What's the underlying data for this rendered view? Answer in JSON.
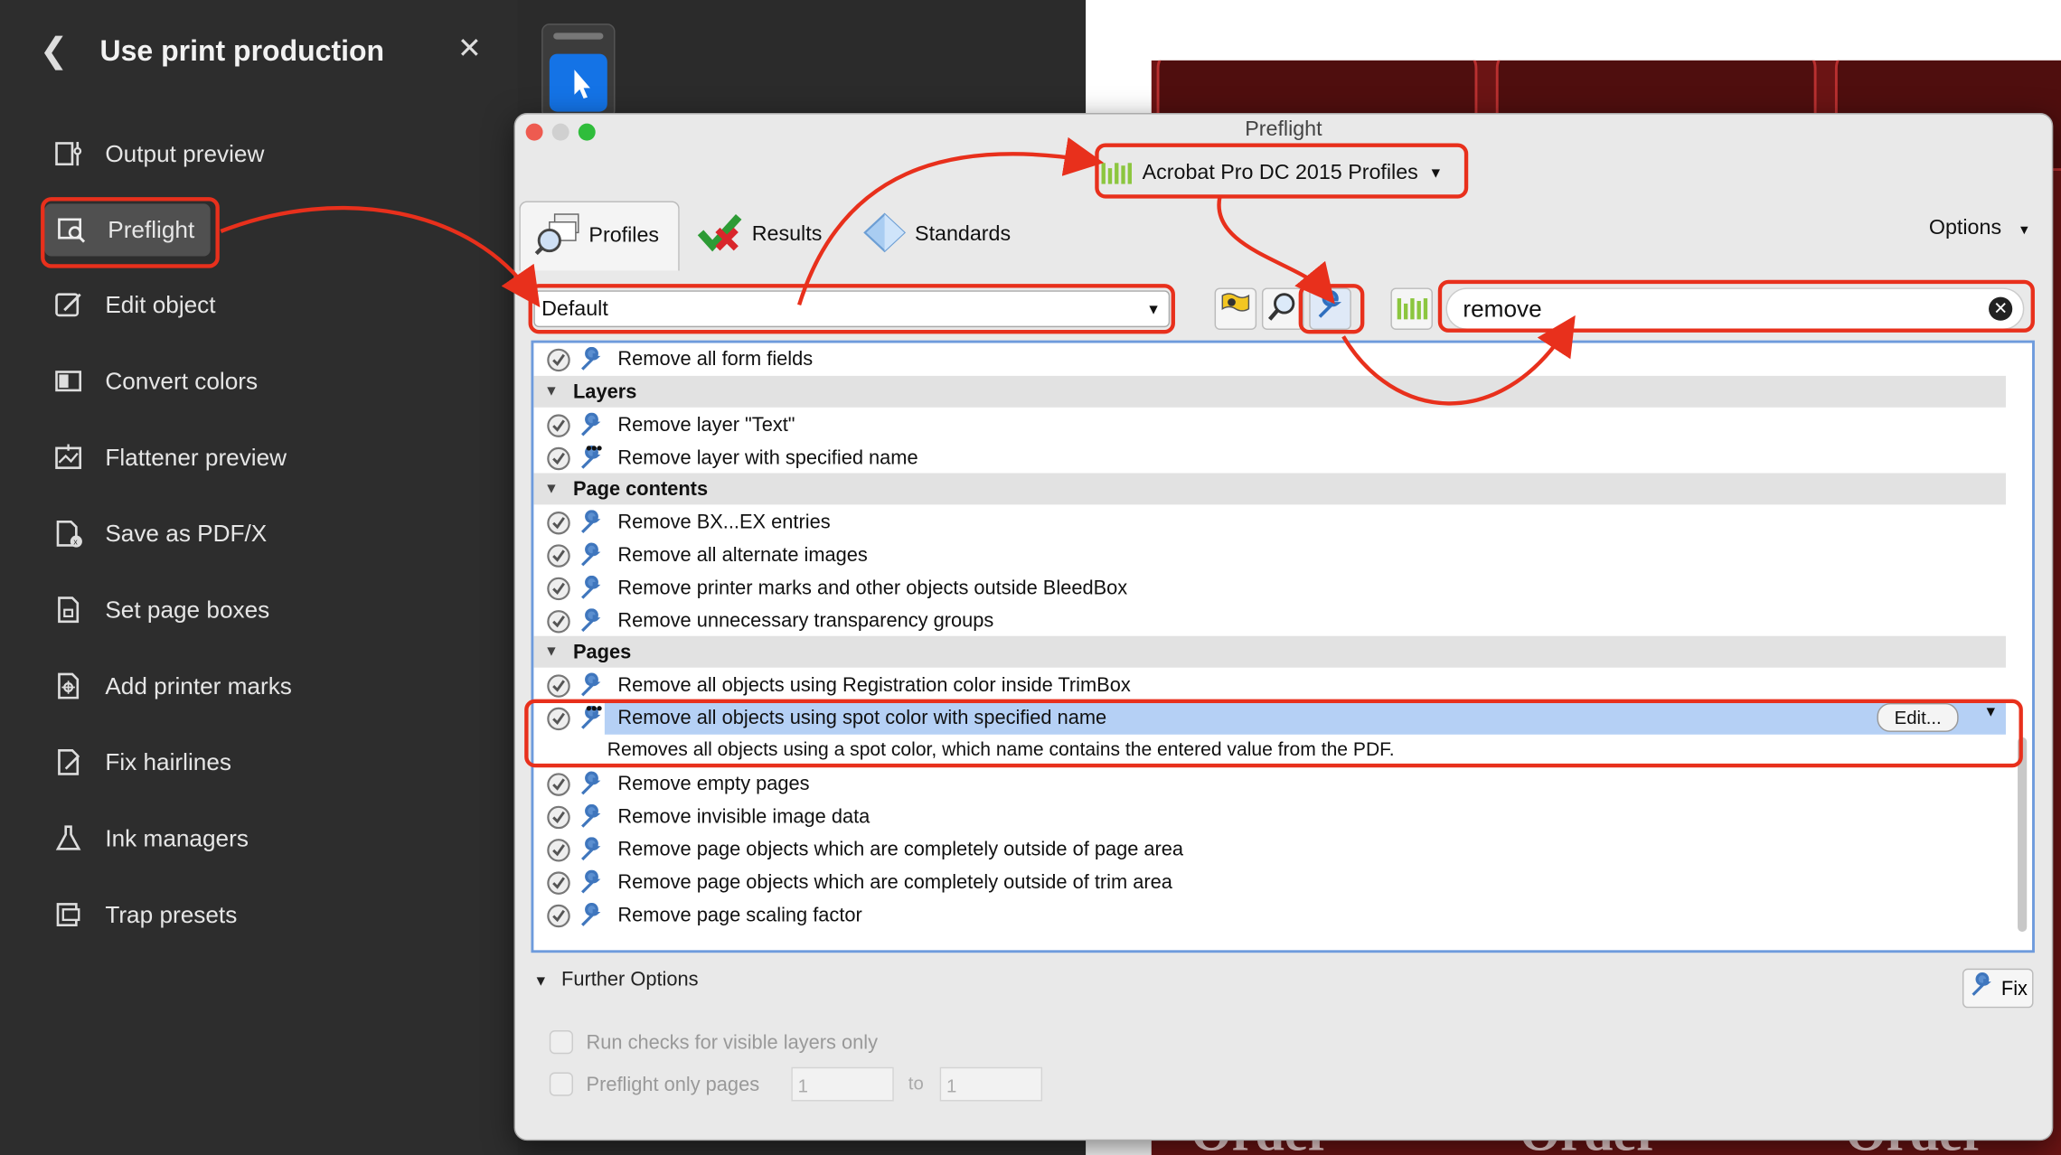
{
  "sidebar": {
    "title": "Use print production",
    "items": [
      {
        "label": "Output preview",
        "icon": "output-preview-icon"
      },
      {
        "label": "Preflight",
        "icon": "preflight-icon",
        "active": true
      },
      {
        "label": "Edit object",
        "icon": "edit-object-icon"
      },
      {
        "label": "Convert colors",
        "icon": "convert-colors-icon"
      },
      {
        "label": "Flattener preview",
        "icon": "flattener-preview-icon"
      },
      {
        "label": "Save as PDF/X",
        "icon": "save-pdfx-icon"
      },
      {
        "label": "Set page boxes",
        "icon": "page-boxes-icon"
      },
      {
        "label": "Add printer marks",
        "icon": "printer-marks-icon"
      },
      {
        "label": "Fix hairlines",
        "icon": "fix-hairlines-icon"
      },
      {
        "label": "Ink managers",
        "icon": "ink-managers-icon"
      },
      {
        "label": "Trap presets",
        "icon": "trap-presets-icon"
      }
    ]
  },
  "window": {
    "title": "Preflight",
    "profile_set": "Acrobat Pro DC 2015 Profiles",
    "tabs": [
      {
        "label": "Profiles",
        "active": true
      },
      {
        "label": "Results"
      },
      {
        "label": "Standards"
      }
    ],
    "options_label": "Options",
    "library_select": "Default",
    "search_value": "remove",
    "top_item": "Remove all form fields",
    "groups": [
      {
        "name": "Layers",
        "items": [
          "Remove layer \"Text\"",
          "Remove layer with specified name"
        ]
      },
      {
        "name": "Page contents",
        "items": [
          "Remove BX...EX entries",
          "Remove all alternate images",
          "Remove printer marks and other objects outside BleedBox",
          "Remove unnecessary transparency groups"
        ]
      },
      {
        "name": "Pages",
        "items": [
          "Remove all objects using Registration color inside TrimBox",
          "Remove all objects using spot color with specified name",
          "Remove empty pages",
          "Remove invisible image data",
          "Remove page objects which are completely outside of page area",
          "Remove page objects which are completely outside of trim area",
          "Remove page scaling factor"
        ]
      }
    ],
    "selected_description": "Removes all objects using a spot color, which name contains the entered value from the PDF.",
    "edit_label": "Edit...",
    "further_options": "Further Options",
    "run_checks_label": "Run checks for visible layers only",
    "preflight_pages_label": "Preflight only pages",
    "page_from": "1",
    "page_to_label": "to",
    "page_to": "1",
    "fix_label": "Fix"
  },
  "document": {
    "bottom_text": "Order"
  },
  "colors": {
    "highlight": "#e8301c",
    "accent_blue": "#1473e6",
    "selection": "#b5d0f5",
    "green_bars": "#8cc63f"
  }
}
